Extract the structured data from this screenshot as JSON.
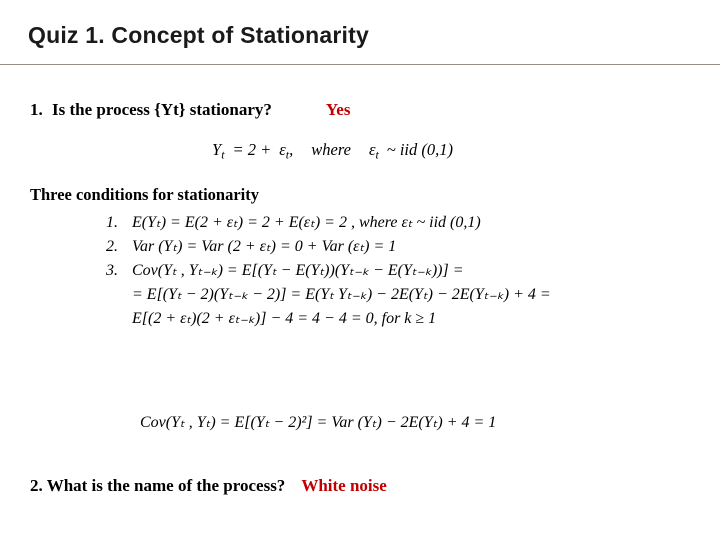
{
  "slide": {
    "title": "Quiz 1. Concept of Stationarity",
    "question1": {
      "number": "1.",
      "text": "Is the process {Yt} stationary?",
      "answer": "Yes",
      "answer_color": "#c00000"
    },
    "main_equation": {
      "lhs": "Y",
      "lhs_sub": "t",
      "body": "= 2 +",
      "eps": "ε",
      "eps_sub": "t",
      "comma": ",",
      "where": "where",
      "eps2": "ε",
      "eps2_sub": "t",
      "dist": "~ iid (0,1)"
    },
    "conditions_heading": "Three conditions for stationarity",
    "conditions": [
      {
        "number": "1.",
        "line": "E(Yₜ) = E(2 + εₜ) = 2 + E(εₜ) = 2 ,    where    εₜ ~ iid (0,1)"
      },
      {
        "number": "2.",
        "line": "Var (Yₜ) = Var (2 + εₜ) = 0 + Var (εₜ) = 1"
      },
      {
        "number": "3.",
        "line": "Cov(Yₜ , Yₜ₋ₖ) = E[(Yₜ − E(Yₜ))(Yₜ₋ₖ − E(Yₜ₋ₖ))] ="
      }
    ],
    "continuation_lines": [
      "= E[(Yₜ − 2)(Yₜ₋ₖ − 2)] = E(Yₜ Yₜ₋ₖ) − 2E(Yₜ) − 2E(Yₜ₋ₖ) + 4 =",
      "E[(2 + εₜ)(2 + εₜ₋ₖ)] − 4 = 4 − 4 = 0,    for    k ≥ 1"
    ],
    "cov_equation": "Cov(Yₜ , Yₜ) = E[(Yₜ − 2)²] = Var (Yₜ) − 2E(Yₜ) + 4 = 1",
    "question2": {
      "text": "2. What is the name of the process?",
      "answer": "White noise",
      "answer_color": "#c00000"
    }
  }
}
